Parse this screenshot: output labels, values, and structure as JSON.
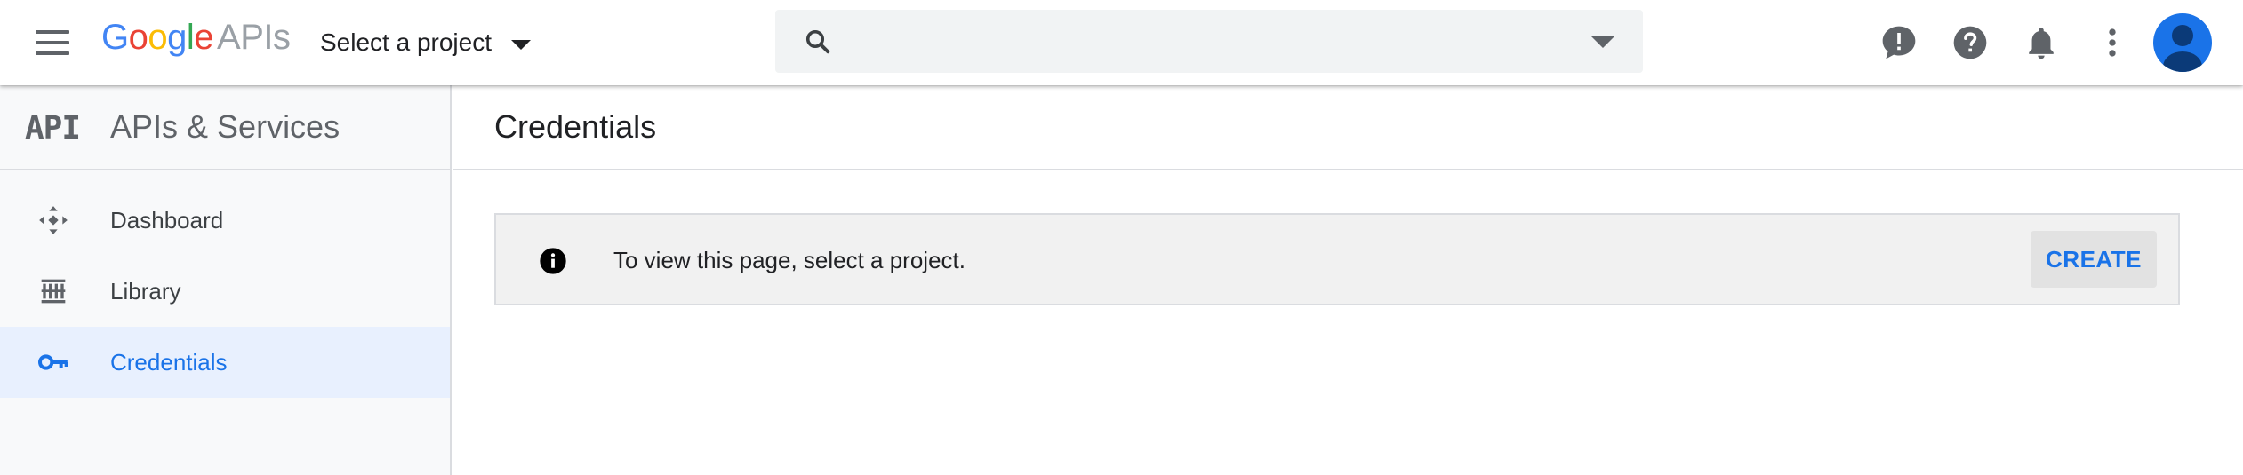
{
  "header": {
    "logo": {
      "g1": "G",
      "o1": "o",
      "o2": "o",
      "g2": "g",
      "l": "l",
      "e": "e",
      "apis": "APIs"
    },
    "project_select_label": "Select a project",
    "search": {
      "value": "",
      "placeholder": ""
    },
    "icons": [
      "menu-icon",
      "search-icon",
      "dropdown-arrow-icon",
      "feedback-icon",
      "help-icon",
      "notifications-icon",
      "more-vert-icon",
      "account-avatar-icon"
    ]
  },
  "sidebar": {
    "badge": "API",
    "title": "APIs & Services",
    "items": [
      {
        "label": "Dashboard",
        "icon": "dashboard-icon",
        "active": false
      },
      {
        "label": "Library",
        "icon": "library-icon",
        "active": false
      },
      {
        "label": "Credentials",
        "icon": "key-icon",
        "active": true
      }
    ]
  },
  "main": {
    "title": "Credentials",
    "notice": {
      "message": "To view this page, select a project.",
      "action_label": "CREATE",
      "icon": "info-icon"
    }
  },
  "colors": {
    "accent": "#1a73e8",
    "sidebar_bg": "#f8f9fa",
    "active_bg": "#e8f0fe",
    "notice_bg": "#f1f1f1",
    "search_bg": "#f1f3f4"
  }
}
